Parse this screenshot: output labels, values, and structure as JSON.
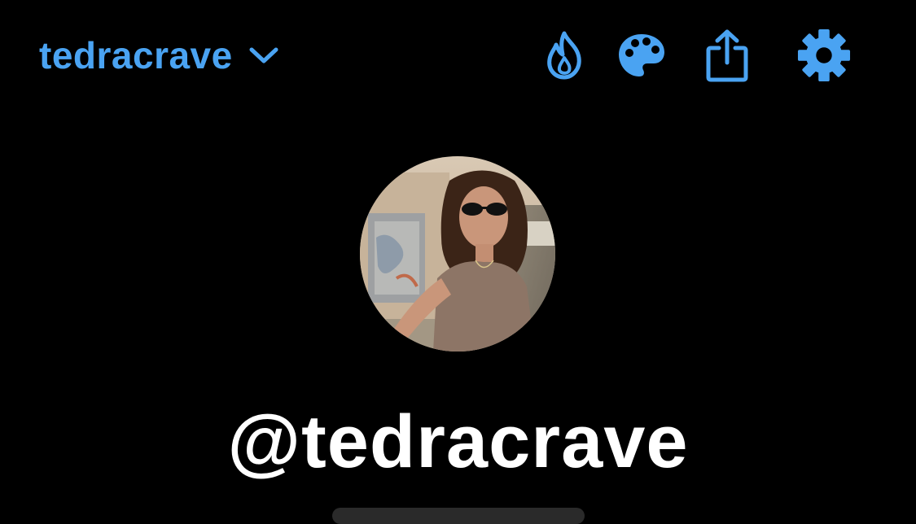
{
  "header": {
    "account_name": "tedracrave",
    "account_dropdown_icon": "chevron-down-icon",
    "actions": [
      {
        "icon": "fire-icon"
      },
      {
        "icon": "palette-icon"
      },
      {
        "icon": "share-icon"
      },
      {
        "icon": "gear-icon"
      }
    ],
    "accent_color": "#4AA3F2"
  },
  "profile": {
    "handle": "@tedracrave",
    "avatar": "profile-photo"
  },
  "colors": {
    "background": "#000000",
    "handle_text": "#FFFFFF"
  }
}
